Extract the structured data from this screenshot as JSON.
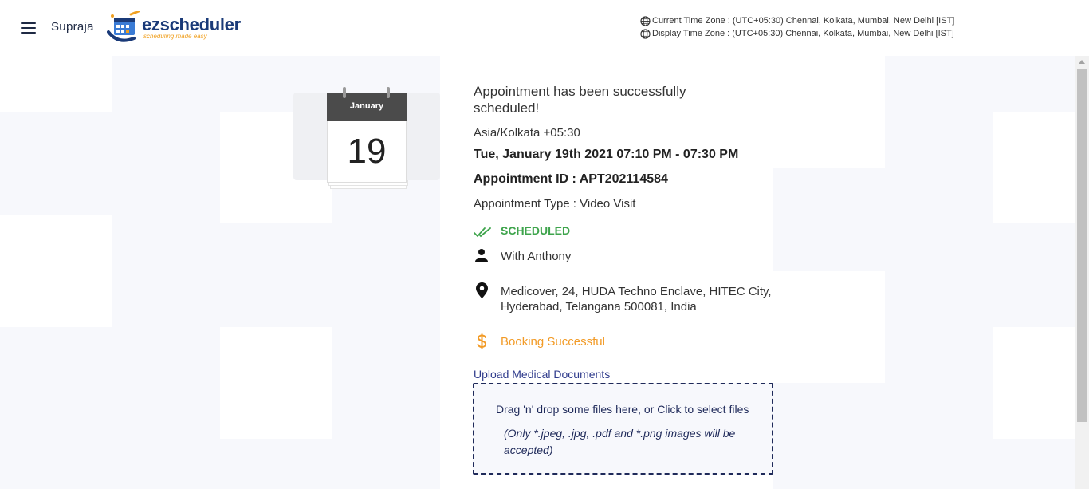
{
  "header": {
    "user_name": "Supraja",
    "logo_text": "ezscheduler",
    "logo_tagline": "scheduling made easy",
    "current_time_zone": "Current Time Zone : (UTC+05:30) Chennai, Kolkata, Mumbai, New Delhi [IST]",
    "display_time_zone": "Display Time Zone : (UTC+05:30) Chennai, Kolkata, Mumbai, New Delhi [IST]"
  },
  "calendar": {
    "month": "January",
    "day": "19"
  },
  "appointment": {
    "success_message": "Appointment has been successfully scheduled!",
    "timezone": "Asia/Kolkata +05:30",
    "datetime": "Tue, January 19th 2021 07:10 PM - 07:30 PM",
    "appointment_id": "Appointment ID : APT202114584",
    "appointment_type": "Appointment Type : Video Visit",
    "status": "SCHEDULED",
    "provider": "With Anthony",
    "address": "Medicover, 24, HUDA Techno Enclave, HITEC City, Hyderabad, Telangana 500081, India",
    "payment_status": "Booking Successful"
  },
  "upload": {
    "link_label": "Upload Medical Documents",
    "drop_text": "Drag 'n' drop some files here, or Click to select files",
    "drop_note": "(Only *.jpeg, .jpg, .pdf and *.png images will be accepted)"
  },
  "colors": {
    "status_green": "#3ea44c",
    "payment_orange": "#f29b27",
    "brand_navy": "#1a3a78",
    "link_blue": "#2f3b8c"
  },
  "icons": {
    "menu": "hamburger-menu-icon",
    "globe": "globe-icon",
    "status": "double-check-icon",
    "provider": "person-icon",
    "address": "location-pin-icon",
    "payment": "dollar-icon"
  }
}
